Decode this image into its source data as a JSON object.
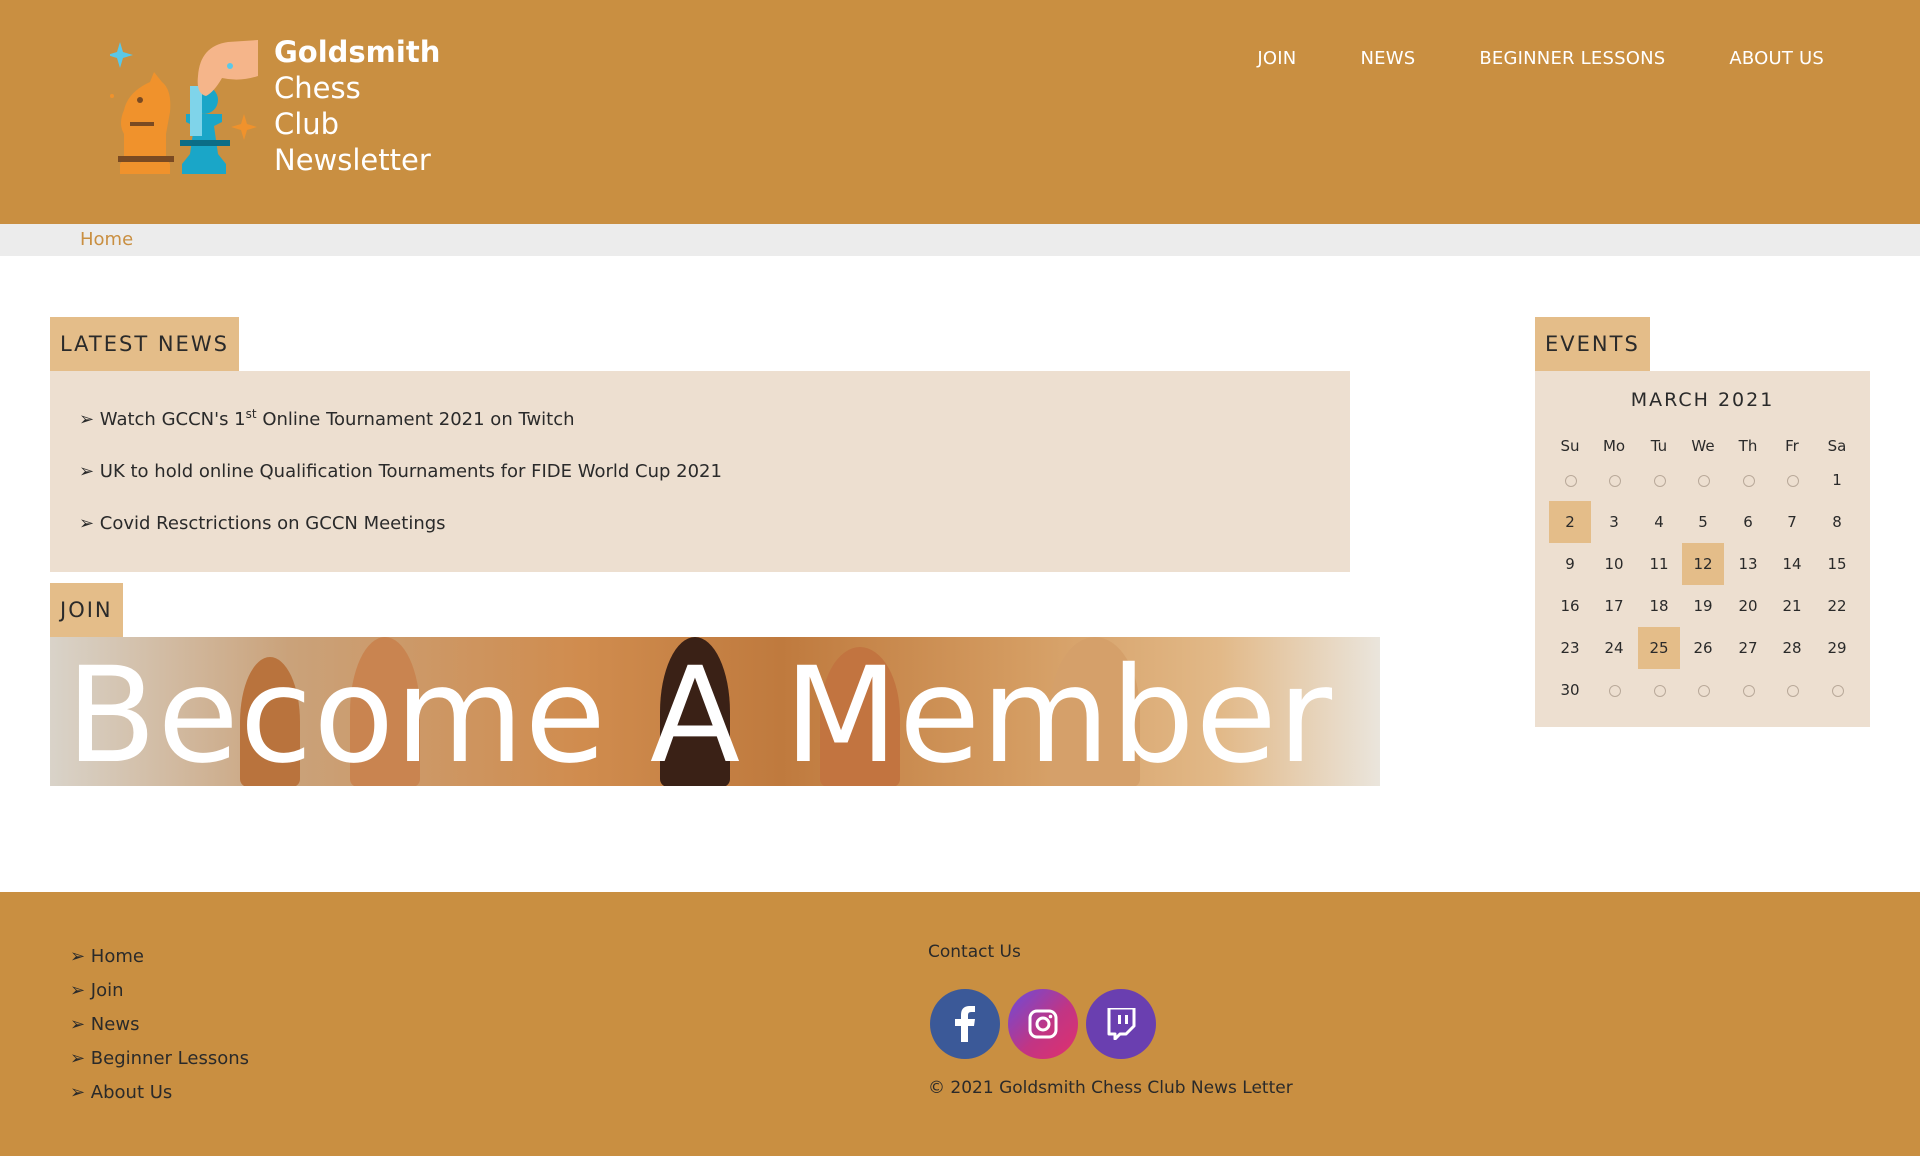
{
  "header": {
    "logo_line1": "Goldsmith",
    "logo_line2": "Chess",
    "logo_line3": "Club",
    "logo_line4": "Newsletter",
    "nav": [
      "JOIN",
      "NEWS",
      "BEGINNER LESSONS",
      "ABOUT US"
    ]
  },
  "breadcrumb": {
    "home": "Home"
  },
  "latest_news": {
    "heading": "LATEST NEWS",
    "items": [
      {
        "prefix": "➢ Watch GCCN's 1",
        "sup": "st",
        "suffix": " Online Tournament 2021 on Twitch"
      },
      {
        "text": "➢ UK to hold online Qualification Tournaments for FIDE World Cup 2021"
      },
      {
        "text": "➢ Covid Resctrictions on GCCN Meetings"
      }
    ]
  },
  "join": {
    "heading": "JOIN",
    "banner_text": "Become A Member"
  },
  "events": {
    "heading": "EVENTS",
    "month": "MARCH 2021",
    "weekdays": [
      "Su",
      "Mo",
      "Tu",
      "We",
      "Th",
      "Fr",
      "Sa"
    ],
    "weeks": [
      [
        "",
        "",
        "",
        "",
        "",
        "",
        "1"
      ],
      [
        "2",
        "3",
        "4",
        "5",
        "6",
        "7",
        "8"
      ],
      [
        "9",
        "10",
        "11",
        "12",
        "13",
        "14",
        "15"
      ],
      [
        "16",
        "17",
        "18",
        "19",
        "20",
        "21",
        "22"
      ],
      [
        "23",
        "24",
        "25",
        "26",
        "27",
        "28",
        "29"
      ],
      [
        "30",
        "",
        "",
        "",
        "",
        "",
        ""
      ]
    ],
    "highlighted_days": [
      "2",
      "12",
      "25"
    ]
  },
  "footer": {
    "links": [
      "➢ Home",
      "➢ Join",
      "➢ News",
      "➢ Beginner Lessons",
      "➢ About Us"
    ],
    "contact_label": "Contact Us",
    "social": [
      "facebook-icon",
      "instagram-icon",
      "twitch-icon"
    ],
    "copyright": "© 2021 Goldsmith Chess Club News Letter"
  },
  "colors": {
    "brand": "#c98f41",
    "tab": "#e4bd89",
    "panel": "#eddfd0",
    "facebook": "#3b5998",
    "twitch": "#6a3fb0"
  }
}
